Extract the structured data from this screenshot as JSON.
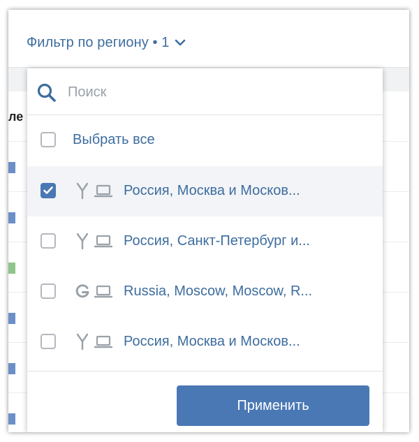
{
  "header": {
    "filter_label": "Фильтр по региону • 1",
    "chevron_icon": "chevron-down-icon"
  },
  "background": {
    "column_label_fragment": "ле"
  },
  "search": {
    "placeholder": "Поиск",
    "value": "",
    "icon": "search-icon"
  },
  "select_all": {
    "label": "Выбрать все",
    "checked": false
  },
  "options": [
    {
      "label": "Россия, Москва и Москов...",
      "checked": true,
      "source_icon": "yandex-icon",
      "device_icon": "laptop-icon"
    },
    {
      "label": "Россия, Санкт-Петербург и...",
      "checked": false,
      "source_icon": "yandex-icon",
      "device_icon": "laptop-icon"
    },
    {
      "label": "Russia, Moscow, Moscow, R...",
      "checked": false,
      "source_icon": "google-icon",
      "device_icon": "laptop-icon"
    },
    {
      "label": "Россия, Москва и Москов...",
      "checked": false,
      "source_icon": "yandex-icon",
      "device_icon": "laptop-icon"
    }
  ],
  "footer": {
    "apply_label": "Применить"
  },
  "colors": {
    "accent": "#4a78b4",
    "link_text": "#3e6d9e",
    "selected_row_bg": "#f2f4f7"
  }
}
